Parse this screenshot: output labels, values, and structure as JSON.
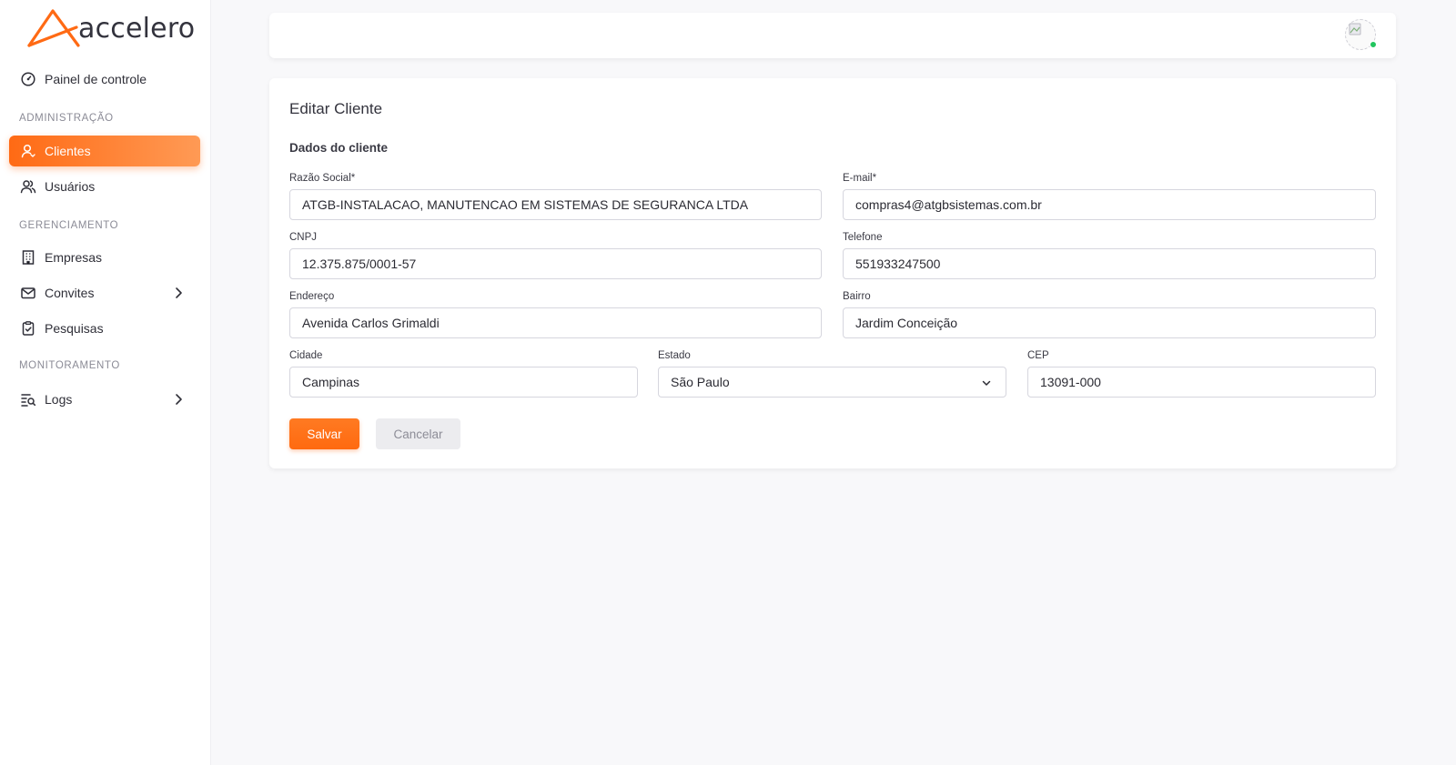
{
  "brand": {
    "name": "accelero",
    "accent": "#ff6a14"
  },
  "sidebar": {
    "dashboard": {
      "label": "Painel de controle",
      "icon": "gauge-icon"
    },
    "sections": [
      {
        "title": "ADMINISTRAÇÃO"
      },
      {
        "title": "GERENCIAMENTO"
      },
      {
        "title": "MONITORAMENTO"
      }
    ],
    "items": [
      {
        "label": "Clientes",
        "icon": "user-icon",
        "active": true
      },
      {
        "label": "Usuários",
        "icon": "users-icon"
      },
      {
        "label": "Empresas",
        "icon": "building-icon"
      },
      {
        "label": "Convites",
        "icon": "mail-icon",
        "expandable": true
      },
      {
        "label": "Pesquisas",
        "icon": "clipboard-check-icon"
      },
      {
        "label": "Logs",
        "icon": "list-search-icon",
        "expandable": true
      }
    ]
  },
  "topbar": {
    "online_status_color": "#22c55e"
  },
  "form": {
    "title": "Editar Cliente",
    "subtitle": "Dados do cliente",
    "fields": {
      "razao_social": {
        "label": "Razão Social*",
        "value": "ATGB-INSTALACAO, MANUTENCAO EM SISTEMAS DE SEGURANCA LTDA"
      },
      "email": {
        "label": "E-mail*",
        "value": "compras4@atgbsistemas.com.br"
      },
      "cnpj": {
        "label": "CNPJ",
        "value": "12.375.875/0001-57"
      },
      "telefone": {
        "label": "Telefone",
        "value": "551933247500"
      },
      "endereco": {
        "label": "Endereço",
        "value": "Avenida Carlos Grimaldi"
      },
      "bairro": {
        "label": "Bairro",
        "value": "Jardim Conceição"
      },
      "cidade": {
        "label": "Cidade",
        "value": "Campinas"
      },
      "estado": {
        "label": "Estado",
        "value": "São Paulo"
      },
      "cep": {
        "label": "CEP",
        "value": "13091-000"
      }
    },
    "buttons": {
      "save": "Salvar",
      "cancel": "Cancelar"
    }
  }
}
